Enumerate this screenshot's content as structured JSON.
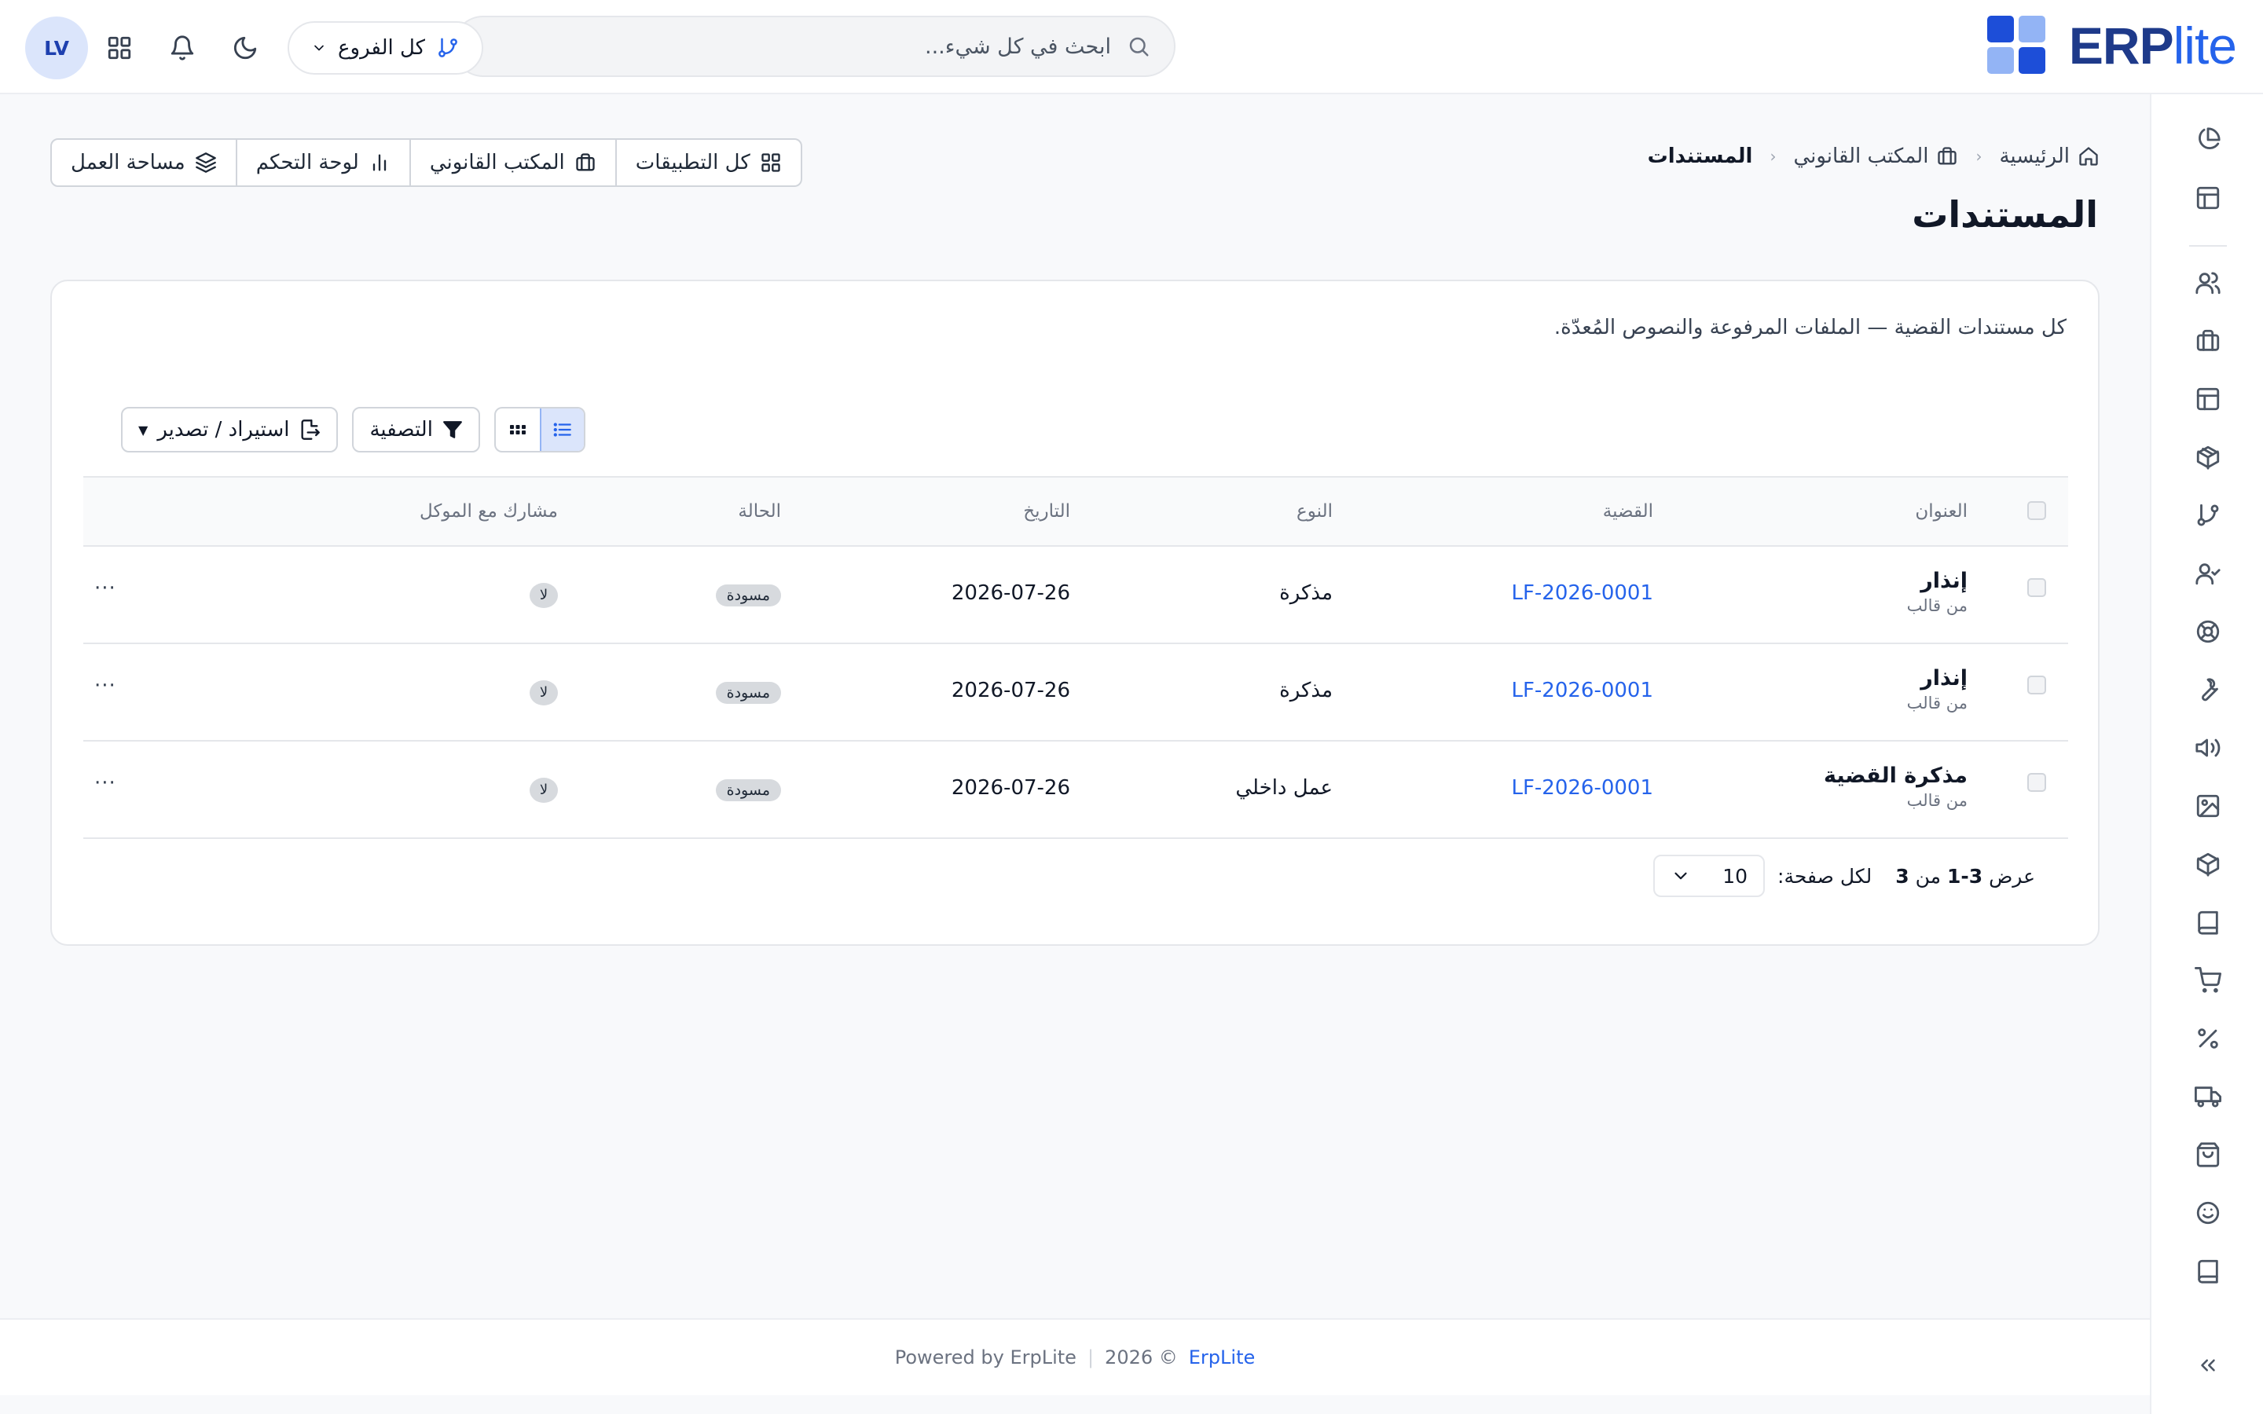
{
  "brand": {
    "name_bold": "ERP",
    "name_light": "lite",
    "colors": [
      "#1d4ed8",
      "#93b4f5",
      "#93b4f5",
      "#1d4ed8"
    ]
  },
  "header": {
    "search_placeholder": "ابحث في كل شيء...",
    "branch_label": "كل الفروع",
    "avatar_initials": "LV"
  },
  "sidebar": {
    "icons": [
      "pie-chart-icon",
      "layout-icon",
      "users-icon",
      "briefcase-icon",
      "layout-alt-icon",
      "package-icon",
      "git-branch-icon",
      "user-check-icon",
      "life-buoy-icon",
      "wrench-icon",
      "megaphone-icon",
      "image-icon",
      "box-icon",
      "book-icon",
      "cart-icon",
      "percent-icon",
      "truck-icon",
      "shopping-bag-icon",
      "smile-icon",
      "book-alt-icon"
    ]
  },
  "breadcrumb": {
    "home": "الرئيسية",
    "section": "المكتب القانوني",
    "current": "المستندات"
  },
  "page": {
    "title": "المستندات"
  },
  "quicklinks": {
    "all_apps": "كل التطبيقات",
    "legal_office": "المكتب القانوني",
    "dashboard": "لوحة التحكم",
    "workspace": "مساحة العمل"
  },
  "card": {
    "description": "كل مستندات القضية — الملفات المرفوعة والنصوص المُعدّة."
  },
  "toolbar": {
    "filter_label": "التصفية",
    "import_export_label": "استيراد / تصدير"
  },
  "table": {
    "columns": {
      "title": "العنوان",
      "case": "القضية",
      "type": "النوع",
      "date": "التاريخ",
      "status": "الحالة",
      "shared": "مشارك مع الموكل"
    },
    "rows": [
      {
        "title": "إنذار",
        "subtitle": "من قالب",
        "case": "LF-2026-0001",
        "type": "مذكرة",
        "date": "2026-07-26",
        "status": "مسودة",
        "shared": "لا"
      },
      {
        "title": "إنذار",
        "subtitle": "من قالب",
        "case": "LF-2026-0001",
        "type": "مذكرة",
        "date": "2026-07-26",
        "status": "مسودة",
        "shared": "لا"
      },
      {
        "title": "مذكرة القضية",
        "subtitle": "من قالب",
        "case": "LF-2026-0001",
        "type": "عمل داخلي",
        "date": "2026-07-26",
        "status": "مسودة",
        "shared": "لا"
      }
    ],
    "more_label": "···"
  },
  "pager": {
    "showing_prefix": "عرض",
    "range": "1-3",
    "of_label": "من",
    "total": "3",
    "per_page_label": "لكل صفحة:",
    "per_page_value": "10"
  },
  "footer": {
    "powered_by": "Powered by ErpLite",
    "separator": "|",
    "copyright": "2026 ©",
    "brand_link": "ErpLite"
  }
}
